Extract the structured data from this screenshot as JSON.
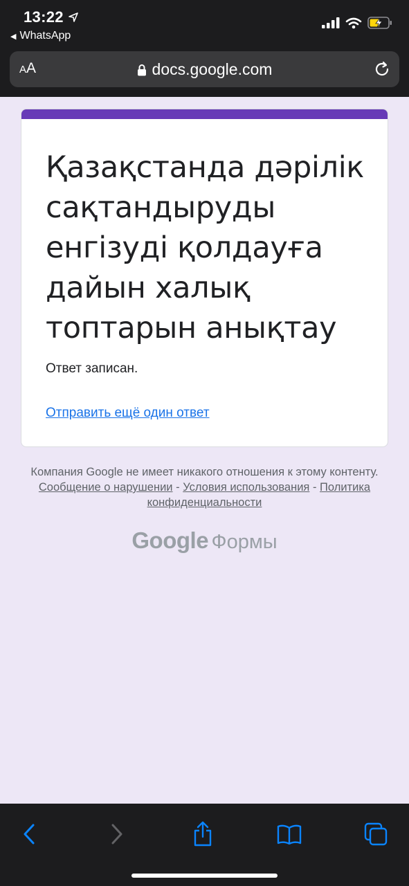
{
  "status_bar": {
    "time": "13:22",
    "back_app": "WhatsApp"
  },
  "browser": {
    "text_size_label_small": "A",
    "text_size_label_large": "A",
    "url": "docs.google.com"
  },
  "form": {
    "title": "Қазақстанда дәрілік сақтандыруды енгізуді қолдауға дайын халық топтарын анықтау",
    "response_note": "Ответ записан.",
    "another_response_link": "Отправить ещё один ответ",
    "accent_color": "#673ab7"
  },
  "footer": {
    "disclaimer": "Компания Google не имеет никакого отношения к этому контенту.",
    "report_link": "Сообщение о нарушении",
    "terms_link": "Условия использования",
    "privacy_link": "Политика конфиденциальности",
    "separator": "-",
    "brand_google": "Google",
    "brand_forms": "Формы"
  },
  "toolbar": {
    "icons": [
      "back-icon",
      "forward-icon",
      "share-icon",
      "bookmarks-icon",
      "tabs-icon"
    ],
    "accent": "#0a84ff"
  }
}
